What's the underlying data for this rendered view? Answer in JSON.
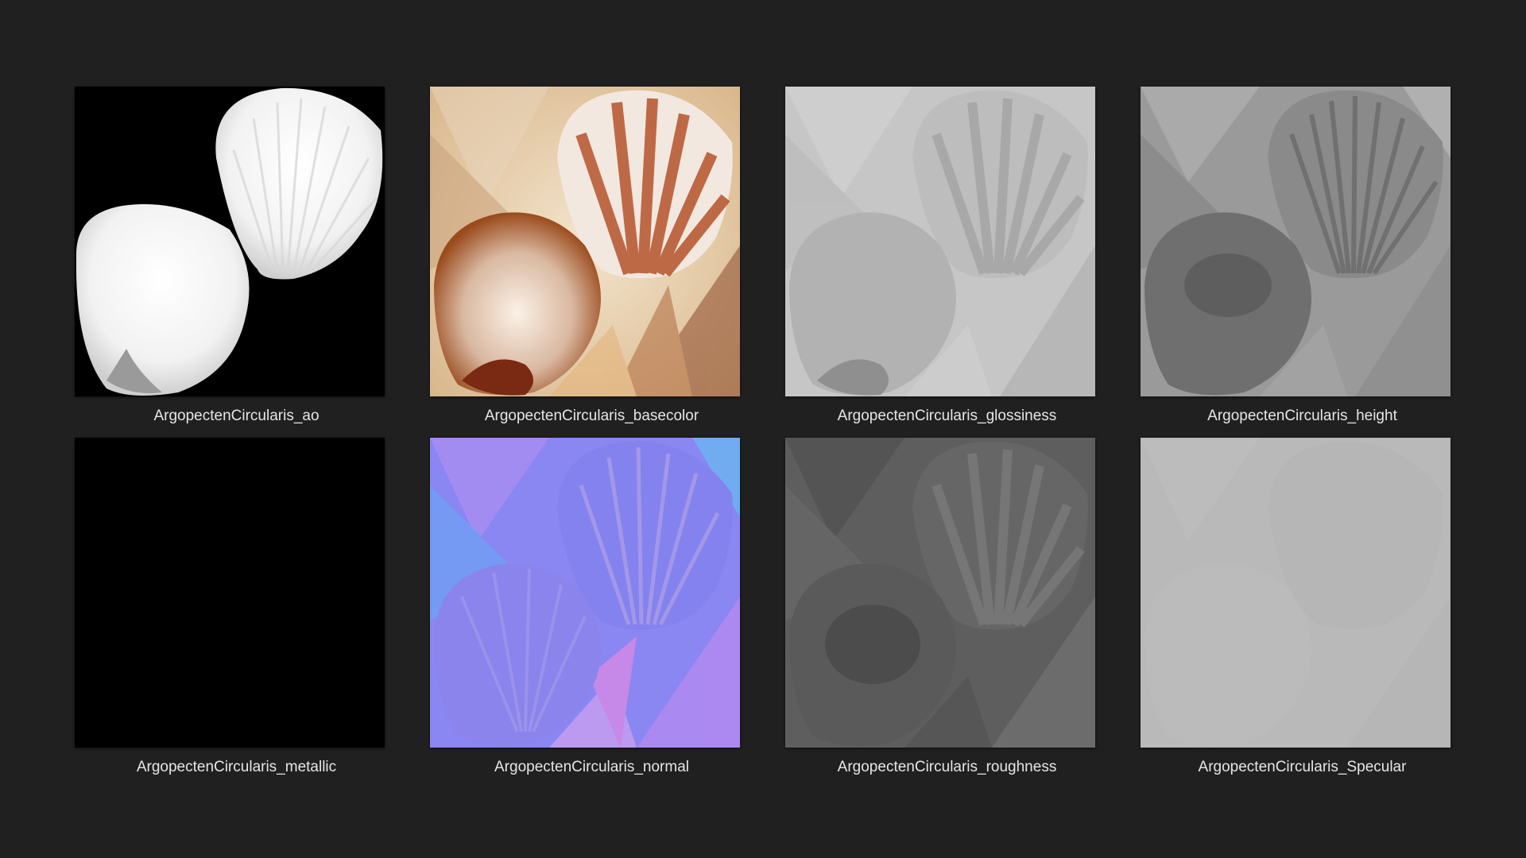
{
  "files": [
    {
      "name": "ArgopectenCircularis_ao",
      "map": "ao"
    },
    {
      "name": "ArgopectenCircularis_basecolor",
      "map": "basecolor"
    },
    {
      "name": "ArgopectenCircularis_glossiness",
      "map": "glossiness"
    },
    {
      "name": "ArgopectenCircularis_height",
      "map": "height"
    },
    {
      "name": "ArgopectenCircularis_metallic",
      "map": "metallic"
    },
    {
      "name": "ArgopectenCircularis_normal",
      "map": "normal"
    },
    {
      "name": "ArgopectenCircularis_roughness",
      "map": "roughness"
    },
    {
      "name": "ArgopectenCircularis_Specular",
      "map": "specular"
    }
  ],
  "colors": {
    "background": "#202020",
    "label": "#e6e6e6"
  }
}
